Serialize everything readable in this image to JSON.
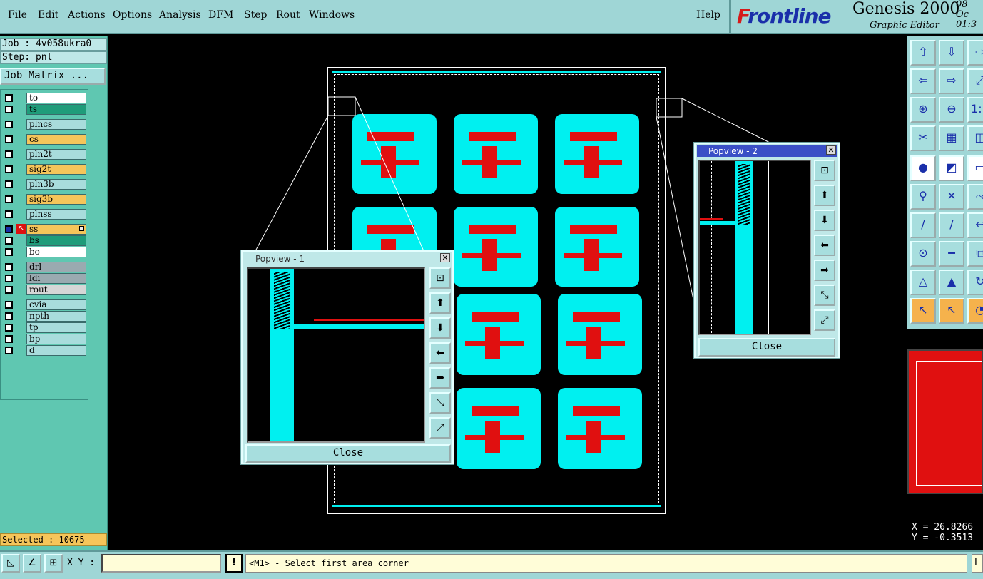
{
  "menu": {
    "items": [
      "File",
      "Edit",
      "Actions",
      "Options",
      "Analysis",
      "DFM",
      "Step",
      "Rout",
      "Windows"
    ],
    "help": "Help"
  },
  "brand": {
    "logo_prefix": "F",
    "logo_rest": "rontline",
    "product": "Genesis 2000",
    "subtitle": "Graphic Editor",
    "date_line1": "08  Oc",
    "date_line2": "01:3"
  },
  "job": {
    "job_label": "Job : 4v058ukra0",
    "step_label": "Step: pnl",
    "matrix_button": "Job Matrix ..."
  },
  "layers": [
    {
      "name": "to",
      "color": "#ffffff"
    },
    {
      "name": "ts",
      "color": "#1f9c7a"
    },
    {
      "name": "plncs",
      "color": "#a8dcdc"
    },
    {
      "name": "cs",
      "color": "#f5c55a"
    },
    {
      "name": "pln2t",
      "color": "#a8dcdc"
    },
    {
      "name": "sig2t",
      "color": "#f5c55a"
    },
    {
      "name": "pln3b",
      "color": "#a8dcdc"
    },
    {
      "name": "sig3b",
      "color": "#f5c55a"
    },
    {
      "name": "plnss",
      "color": "#a8dcdc"
    },
    {
      "name": "ss",
      "color": "#f5c55a"
    },
    {
      "name": "bs",
      "color": "#1f9c7a"
    },
    {
      "name": "bo",
      "color": "#ffffff"
    },
    {
      "name": "drl",
      "color": "#9aaab0"
    },
    {
      "name": "ldi",
      "color": "#9aaab0"
    },
    {
      "name": "rout",
      "color": "#d6d6d6"
    },
    {
      "name": "cvia",
      "color": "#a8dcdc"
    },
    {
      "name": "npth",
      "color": "#a8dcdc"
    },
    {
      "name": "tp",
      "color": "#a8dcdc"
    },
    {
      "name": "bp",
      "color": "#a8dcdc"
    },
    {
      "name": "d",
      "color": "#a8dcdc"
    }
  ],
  "selected": "Selected : 10675",
  "popview1": {
    "title": "Popview - 1",
    "close": "Close"
  },
  "popview2": {
    "title": "Popview - 2",
    "close": "Close"
  },
  "coords": {
    "x": "X = 26.8266",
    "y": "Y = -0.3513"
  },
  "status": {
    "xy_label": "X Y :",
    "xy_value": "",
    "message_icon": "!",
    "message": "<M1> - Select first area corner",
    "right_char": "I"
  },
  "colors": {
    "copper": "#e01010",
    "soldermask": "#00f0f0",
    "accent": "#1a2faa",
    "panel": "#9fd6d6"
  },
  "icons": {
    "popview_tools": [
      "zoom-fit-icon",
      "pan-up-icon",
      "pan-down-icon",
      "pan-left-icon",
      "pan-right-icon",
      "zoom-out-icon",
      "zoom-in-icon"
    ],
    "toolbar": [
      "pan-up-icon",
      "pan-down-icon",
      "pan-right-icon",
      "pan-left-icon",
      "pan-right-icon-2",
      "scale-icon",
      "zoom-in-icon",
      "zoom-out-icon",
      "ratio-icon",
      "measure-icon",
      "grid-icon",
      "snap-icon",
      "pad-icon",
      "clip-icon",
      "ruler-icon",
      "connect-icon",
      "cross-icon",
      "move-icon",
      "line-icon",
      "slant-line-icon",
      "arc-icon",
      "point-icon",
      "hline-icon",
      "copy-icon",
      "triangle-icon",
      "arrow-triangle-icon",
      "rotate-icon",
      "select-arrow-icon",
      "select-arrow-2-icon",
      "select-circle-icon"
    ]
  }
}
